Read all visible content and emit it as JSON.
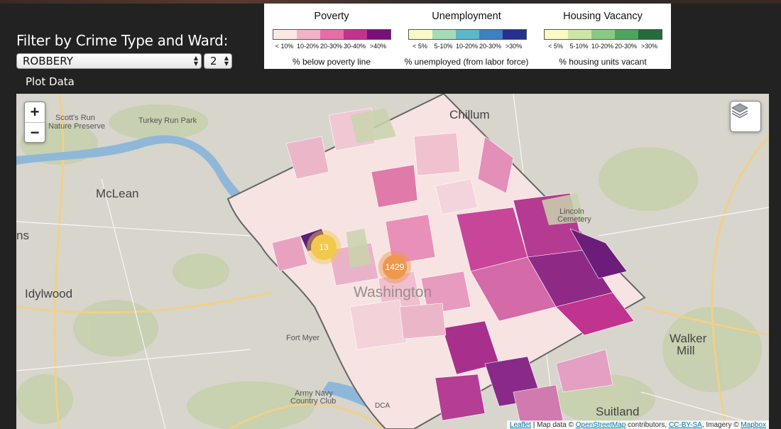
{
  "filter": {
    "title": "Filter by Crime Type and Ward:",
    "crime_type": "ROBBERY",
    "ward": "2",
    "plot_button": "Plot Data"
  },
  "legend": [
    {
      "title": "Poverty",
      "colors": [
        "#fbe8e3",
        "#f2b3c6",
        "#e56ea8",
        "#c0338f",
        "#7a0f78"
      ],
      "ticks": [
        "< 10%",
        "10-20%",
        "20-30%",
        "30-40%",
        ">40%"
      ],
      "caption": "% below poverty line"
    },
    {
      "title": "Unemployment",
      "colors": [
        "#fbf9c6",
        "#a6dbb7",
        "#5bb7c9",
        "#3f80c0",
        "#25308f"
      ],
      "ticks": [
        "< 5%",
        "5-10%",
        "10-20%",
        "20-30%",
        ">30%"
      ],
      "caption": "% unemployed (from labor force)"
    },
    {
      "title": "Housing Vacancy",
      "colors": [
        "#fbf9c6",
        "#cde7a3",
        "#88c986",
        "#4ca45d",
        "#276a3b"
      ],
      "ticks": [
        "< 5%",
        "5-10%",
        "10-20%",
        "20-30%",
        ">30%"
      ],
      "caption": "% housing units vacant"
    }
  ],
  "map": {
    "zoom_in": "+",
    "zoom_out": "−",
    "layers_icon": "layers-icon",
    "clusters": [
      {
        "count": "13",
        "color": "#f2c94c"
      },
      {
        "count": "1429",
        "color": "#f0974e"
      }
    ],
    "places": [
      {
        "name": "McLean",
        "kind": "big"
      },
      {
        "name": "Idylwood",
        "kind": "big"
      },
      {
        "name": "Washington",
        "kind": "city"
      },
      {
        "name": "Chillum",
        "kind": "big"
      },
      {
        "name": "Suitland",
        "kind": "big"
      },
      {
        "name": "Walker",
        "kind": "big"
      },
      {
        "name": "Mill",
        "kind": "big"
      },
      {
        "name": "Fort Myer",
        "kind": "normal"
      },
      {
        "name": "Army Navy",
        "kind": "normal"
      },
      {
        "name": "Country Club",
        "kind": "normal"
      },
      {
        "name": "Scott's Run",
        "kind": "normal"
      },
      {
        "name": "Nature Preserve",
        "kind": "normal"
      },
      {
        "name": "Turkey Run Park",
        "kind": "normal"
      },
      {
        "name": "DCA",
        "kind": "normal"
      },
      {
        "name": "ns",
        "kind": "big"
      },
      {
        "name": "Lincoln",
        "kind": "normal"
      },
      {
        "name": "Cemetery",
        "kind": "normal"
      }
    ],
    "attribution": {
      "leaflet": "Leaflet",
      "sep1": " | Map data © ",
      "osm": "OpenStreetMap",
      "sep2": " contributors, ",
      "ccbysa": "CC-BY-SA",
      "sep3": ", Imagery © ",
      "mapbox": "Mapbox"
    }
  }
}
